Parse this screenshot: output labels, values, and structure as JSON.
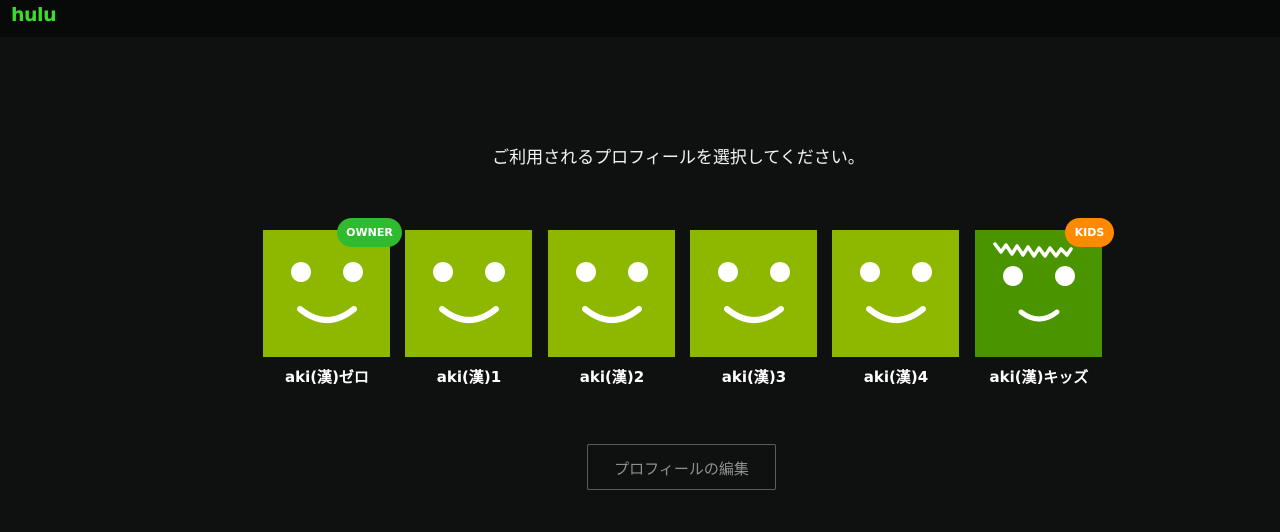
{
  "header": {
    "logo_text": "hulu",
    "logo_color": "#3ddb2f"
  },
  "main": {
    "prompt": "ご利用されるプロフィールを選択してください。",
    "profiles": [
      {
        "name": "aki(漢)ゼロ",
        "badge": "OWNER",
        "avatar": "smiley-face",
        "color": "#8eb800"
      },
      {
        "name": "aki(漢)1",
        "avatar": "smiley-face",
        "color": "#8eb800"
      },
      {
        "name": "aki(漢)2",
        "avatar": "smiley-face",
        "color": "#8eb800"
      },
      {
        "name": "aki(漢)3",
        "avatar": "smiley-face",
        "color": "#8eb800"
      },
      {
        "name": "aki(漢)4",
        "avatar": "smiley-face",
        "color": "#8eb800"
      },
      {
        "name": "aki(漢)キッズ",
        "badge": "KIDS",
        "avatar": "kids-smiley-face",
        "color": "#4a9400"
      }
    ],
    "edit_button_label": "プロフィールの編集"
  },
  "colors": {
    "background": "#0f1010",
    "owner_badge": "#2fba2f",
    "kids_badge": "#ff8a00"
  }
}
